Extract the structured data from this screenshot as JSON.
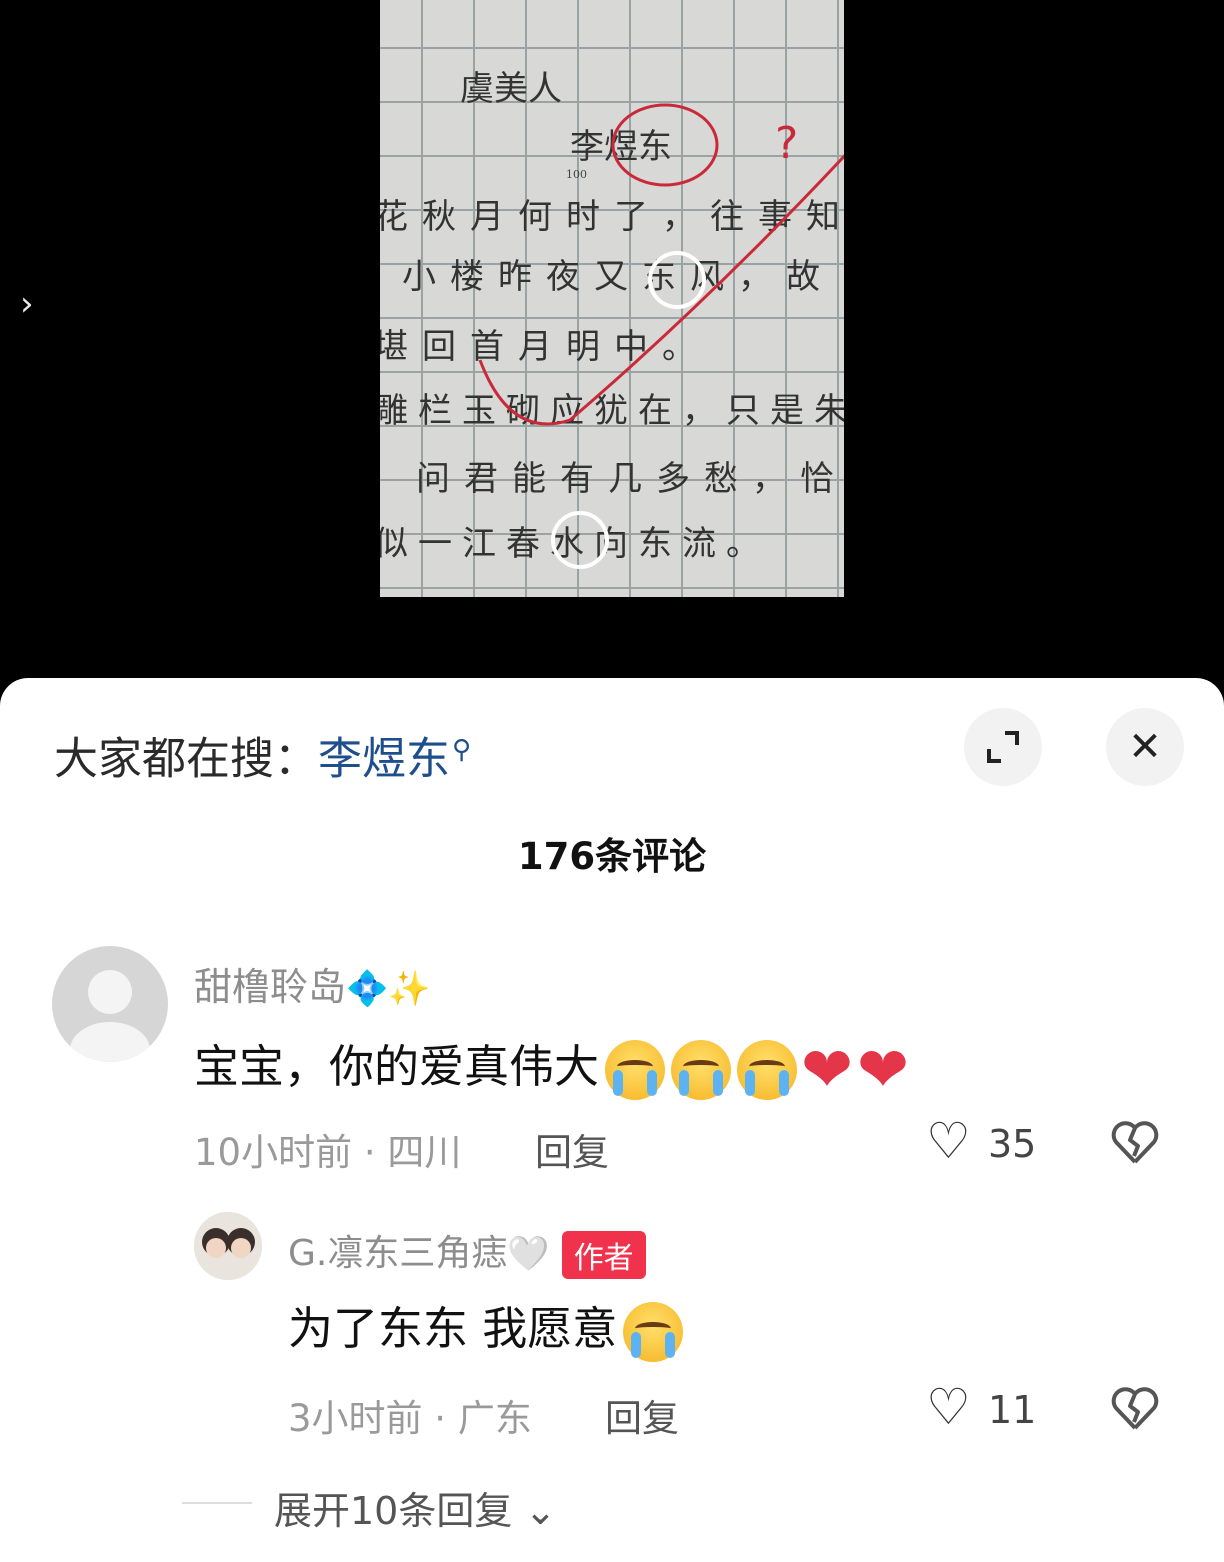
{
  "media": {
    "nav": {
      "side_arrow": "›",
      "corner_arrow": "‹"
    },
    "paper": {
      "title": "虞美人",
      "author": "李煜东",
      "score": "100",
      "rows": [
        "花秋月何时了，往事知",
        "小楼昨夜又东风，故",
        "堪回首月明中。",
        "雕栏玉砌应犹在，只是朱",
        "问君能有几多愁，恰",
        "似一江春水向东流。"
      ],
      "annotation": "?"
    }
  },
  "search": {
    "prefix": "大家都在搜：",
    "term": "李煜东",
    "icon": "search-icon"
  },
  "buttons": {
    "expand_icon": "expand-icon",
    "close_icon": "close-icon",
    "close_glyph": "✕"
  },
  "comments_count": "176条评论",
  "comment": {
    "username": "甜橹聆岛",
    "username_decoration": "💠✨",
    "text": "宝宝，你的爱真伟大",
    "emojis": [
      "crying-face",
      "crying-face",
      "crying-face",
      "red-heart",
      "red-heart"
    ],
    "meta": "10小时前 · 四川",
    "reply_label": "回复",
    "likes": "35"
  },
  "reply": {
    "username": "G.凛东三角痣",
    "username_decoration": "🤍",
    "badge": "作者",
    "text": "为了东东 我愿意",
    "emojis": [
      "crying-face"
    ],
    "meta": "3小时前 · 广东",
    "reply_label": "回复",
    "likes": "11"
  },
  "expand_replies": "展开10条回复",
  "icons": {
    "like": "heart-outline-icon",
    "dislike": "broken-heart-icon",
    "chevron": "chevron-down-icon"
  }
}
